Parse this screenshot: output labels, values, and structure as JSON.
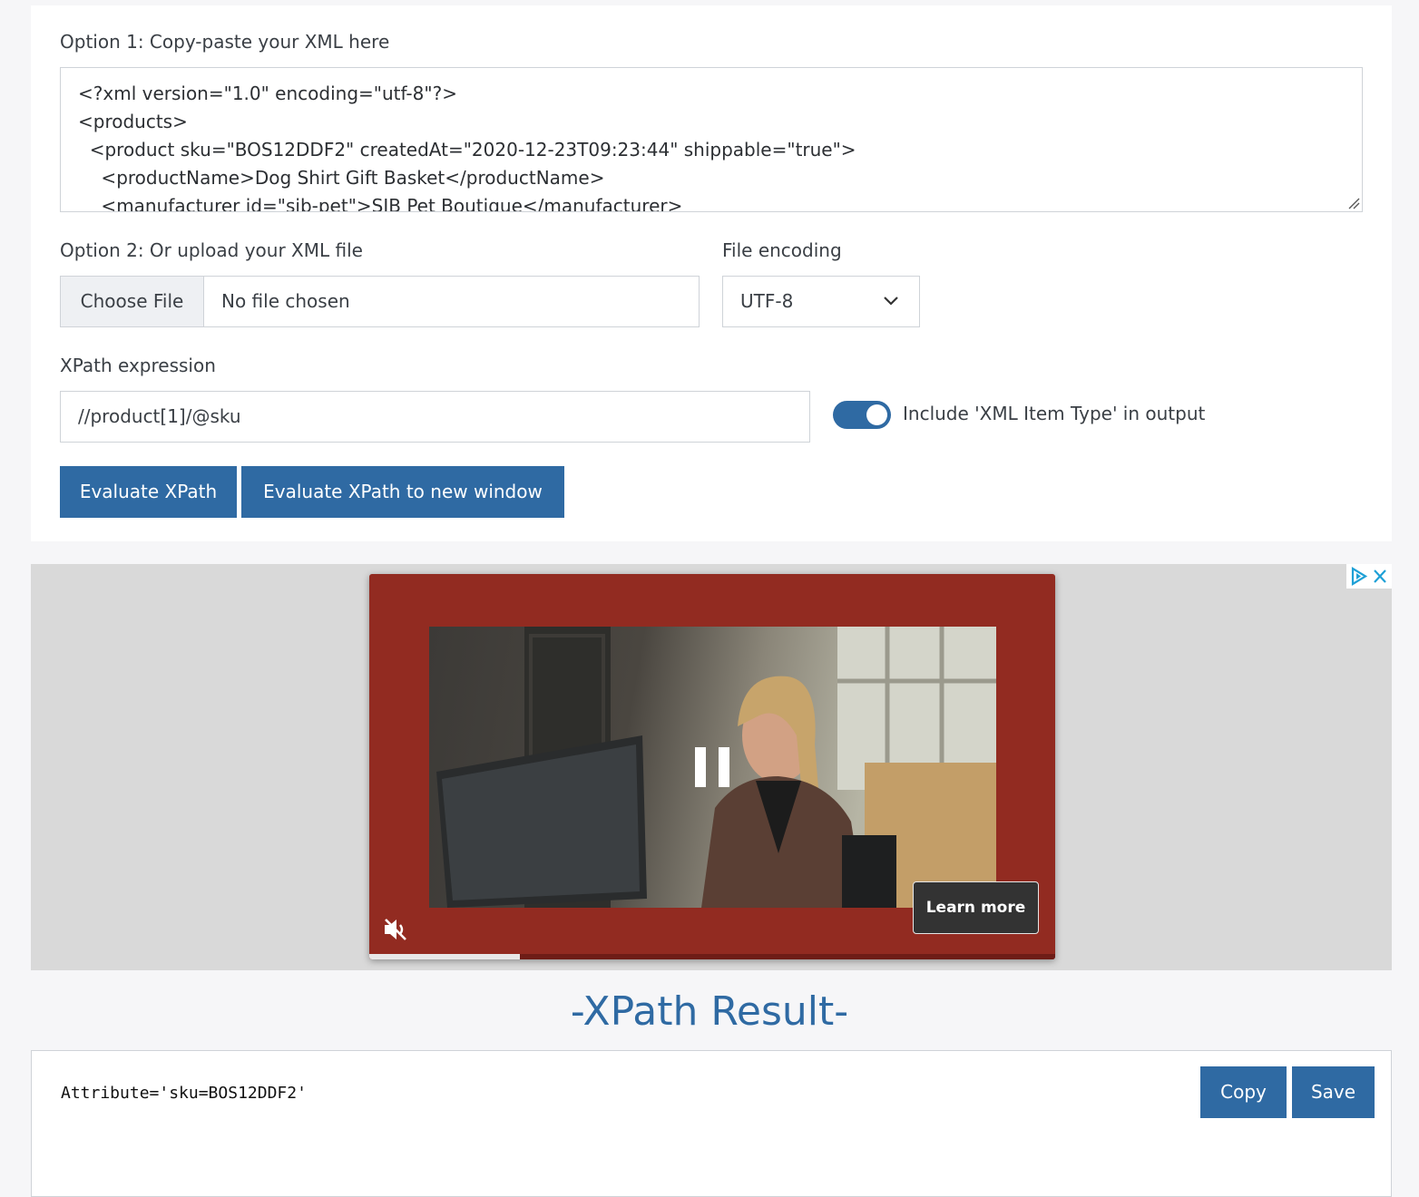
{
  "form": {
    "option1_label": "Option 1: Copy-paste your XML here",
    "xml_lines": [
      "<?xml version=\"1.0\" encoding=\"utf-8\"?>",
      "<products>",
      "  <product sku=\"BOS12DDF2\" createdAt=\"2020-12-23T09:23:44\" shippable=\"true\">",
      "    <productName>Dog Shirt Gift Basket</productName>",
      "    <manufacturer id=\"sjb-pet\">SJB Pet Boutique</manufacturer>"
    ],
    "option2_label": "Option 2: Or upload your XML file",
    "choose_file_label": "Choose File",
    "file_status": "No file chosen",
    "encoding_label": "File encoding",
    "encoding_value": "UTF-8",
    "xpath_label": "XPath expression",
    "xpath_value": "//product[1]/@sku",
    "include_type_label": "Include 'XML Item Type' in output",
    "include_type_enabled": true,
    "evaluate_label": "Evaluate XPath",
    "evaluate_new_window_label": "Evaluate XPath to new window",
    "accent_color": "#2f6aa3"
  },
  "ad": {
    "learn_more_label": "Learn more",
    "progress_fraction": 0.22,
    "frame_color": "#922b21"
  },
  "result": {
    "title": "-XPath Result-",
    "output_text": "Attribute='sku=BOS12DDF2'",
    "copy_label": "Copy",
    "save_label": "Save"
  }
}
